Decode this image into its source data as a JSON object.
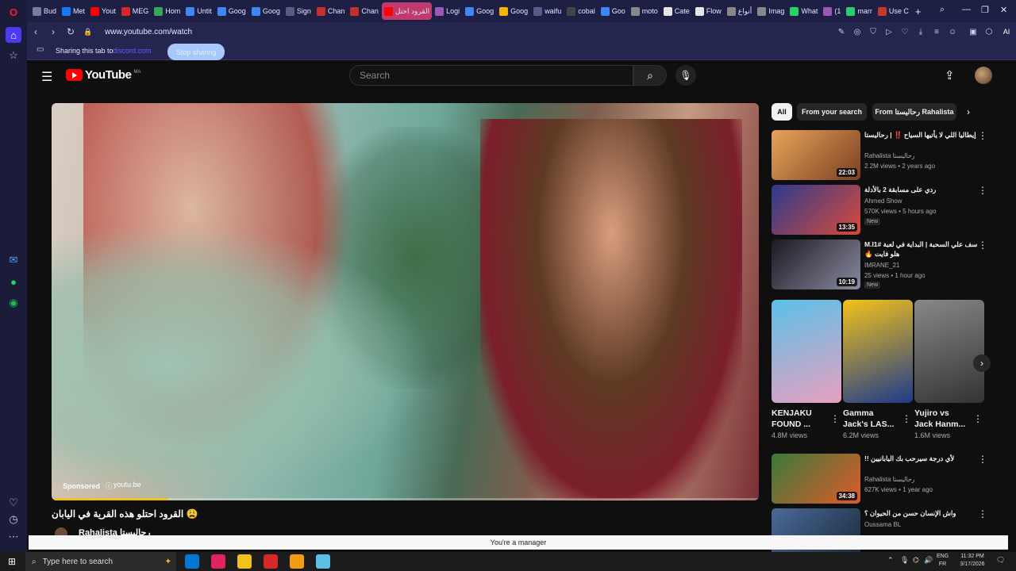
{
  "browser": {
    "tabs": [
      {
        "label": "Bud",
        "color": "#7a7a9a"
      },
      {
        "label": "Met",
        "color": "#1877f2"
      },
      {
        "label": "Yout",
        "color": "#ff0000"
      },
      {
        "label": "MEG",
        "color": "#d62828"
      },
      {
        "label": "Hom",
        "color": "#34a853"
      },
      {
        "label": "Untit",
        "color": "#4285f4"
      },
      {
        "label": "Goog",
        "color": "#4285f4"
      },
      {
        "label": "Goog",
        "color": "#4285f4"
      },
      {
        "label": "Sign",
        "color": "#5a5a8a"
      },
      {
        "label": "Chan",
        "color": "#c4302b"
      },
      {
        "label": "Chan",
        "color": "#c4302b"
      },
      {
        "label": "القرود احتل",
        "color": "#ff0000",
        "active": true
      },
      {
        "label": "Logi",
        "color": "#9b59b6"
      },
      {
        "label": "Goog",
        "color": "#4285f4"
      },
      {
        "label": "Goog",
        "color": "#f4b400"
      },
      {
        "label": "waifu",
        "color": "#5a5a8a"
      },
      {
        "label": "cobal",
        "color": "#444"
      },
      {
        "label": "Goo",
        "color": "#4285f4"
      },
      {
        "label": "moto",
        "color": "#888"
      },
      {
        "label": "Cate",
        "color": "#e6e6e6"
      },
      {
        "label": "Flow",
        "color": "#e6e6e6"
      },
      {
        "label": "أنواع",
        "color": "#888"
      },
      {
        "label": "Imag",
        "color": "#888"
      },
      {
        "label": "What",
        "color": "#25d366"
      },
      {
        "label": "(1",
        "color": "#9b59b6"
      },
      {
        "label": "marr",
        "color": "#2ecc71"
      },
      {
        "label": "Use C",
        "color": "#c0392b"
      }
    ],
    "url": "www.youtube.com/watch",
    "ai_label": "AI",
    "share": {
      "text": "Sharing this tab to",
      "target": "discord.com",
      "stop_label": "Stop sharing"
    }
  },
  "youtube": {
    "logo_text": "YouTube",
    "country_code": "MA",
    "search_placeholder": "Search",
    "chips": [
      "All",
      "From your search",
      "From رحاليستا Rahalista"
    ],
    "player": {
      "sponsored_label": "Sponsored",
      "ad_info": "ⓘ",
      "ad_domain": "youtu.be",
      "progress": 0.165
    },
    "video_title": "القرود احتلو هذه القرية في اليابان 😩",
    "channel_name": "Rahalista رحاليستا",
    "recommendations": [
      {
        "title": "إيطاليا اللي لا يأتيها السياح ‼️ | رحاليستا",
        "channel": "Rahalista رحاليستا",
        "meta": "2.2M views • 2 years ago",
        "duration": "22:03",
        "new": "",
        "colors": [
          "#e7a45a",
          "#7b3f22"
        ]
      },
      {
        "title": "ردي على مسابقة 2 بالأدلة",
        "channel": "Ahmed Show",
        "meta": "570K views • 5 hours ago",
        "duration": "13:35",
        "new": "New",
        "colors": [
          "#2b3a8e",
          "#d94b3a"
        ]
      },
      {
        "title": "سف علي السحبة | البداية في لعبة #M.I1 هلو فايت 🔥",
        "channel": "IMRANE_21",
        "meta": "25 views • 1 hour ago",
        "duration": "10:19",
        "new": "New",
        "colors": [
          "#1a1a22",
          "#8a8aa0"
        ]
      },
      {
        "title": "لأي درجة سيرحب بك اليابانيين !!",
        "channel": "Rahalista رحاليستا",
        "meta": "627K views • 1 year ago",
        "duration": "34:38",
        "new": "",
        "colors": [
          "#3a7a3a",
          "#e05a2a"
        ]
      },
      {
        "title": "واش الإنسان حسن من الحيوان ؟",
        "channel": "Oussama BL",
        "meta": "",
        "duration": "",
        "new": "",
        "colors": [
          "#4a6a9a",
          "#1a2a3a"
        ]
      }
    ],
    "shorts": [
      {
        "title": "KENJAKU FOUND ...",
        "views": "4.8M views",
        "colors": [
          "#5bc0e8",
          "#e8a0c0"
        ]
      },
      {
        "title": "Gamma Jack's LAS...",
        "views": "6.2M views",
        "colors": [
          "#f2c21b",
          "#1e3a8a"
        ]
      },
      {
        "title": "Yujiro vs Jack Hanm...",
        "views": "1.6M views",
        "colors": [
          "#888",
          "#333"
        ]
      }
    ],
    "manager_notice": "You're a manager"
  },
  "taskbar": {
    "search_placeholder": "Type here to search",
    "lang_top": "ENG",
    "lang_bottom": "FR",
    "time": "11:32 PM",
    "date": "3/17/2026",
    "apps": [
      "#0078d4",
      "#e0245e",
      "#f2c21b",
      "#d62828",
      "#f39c12",
      "#5bc0e8"
    ]
  }
}
